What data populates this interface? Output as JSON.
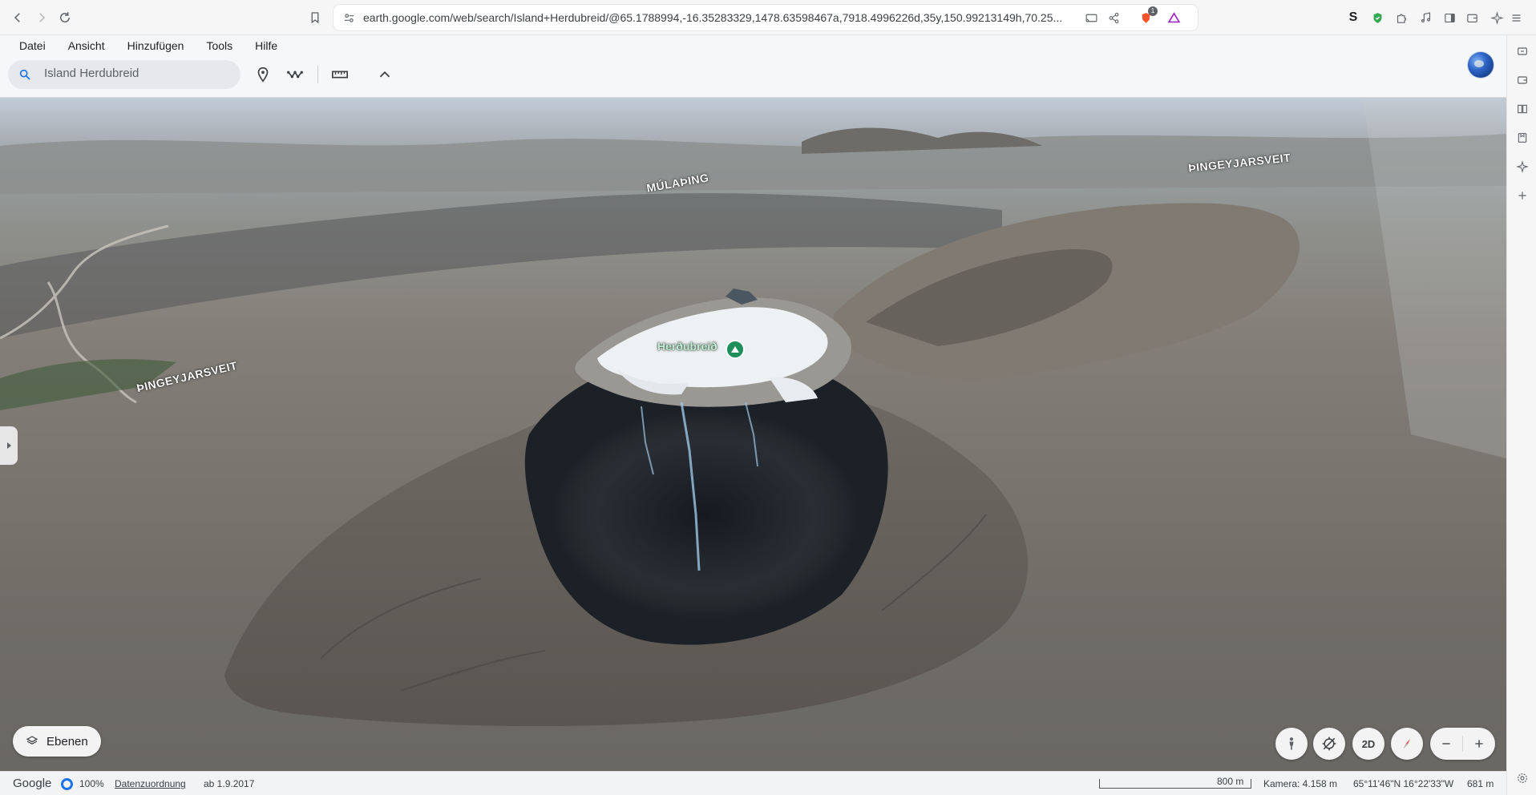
{
  "browser": {
    "url": "earth.google.com/web/search/Island+Herdubreid/@65.1788994,-16.35283329,1478.63598467a,7918.4996226d,35y,150.99213149h,70.25...",
    "brave_badge": "1",
    "ext_letter": "S"
  },
  "menu": {
    "items": [
      "Datei",
      "Ansicht",
      "Hinzufügen",
      "Tools",
      "Hilfe"
    ]
  },
  "search": {
    "value": "Island Herdubreid"
  },
  "map": {
    "labels": {
      "mulathing": "MÚLAÞING",
      "thing_left": "ÞINGEYJARSVEIT",
      "thing_right": "ÞINGEYJARSVEIT"
    },
    "peak": {
      "name": "Herðubreið"
    }
  },
  "controls": {
    "layers_label": "Ebenen",
    "view_2d": "2D"
  },
  "status": {
    "google": "Google",
    "percent": "100%",
    "attribution": "Datenzuordnung",
    "date": "ab 1.9.2017",
    "scale": "800 m",
    "camera": "Kamera: 4.158 m",
    "coords": "65°11'46\"N 16°22'33\"W",
    "altitude": "681 m"
  },
  "colors": {
    "accent": "#1a73e8",
    "peak_pin": "#1e8e5a"
  }
}
